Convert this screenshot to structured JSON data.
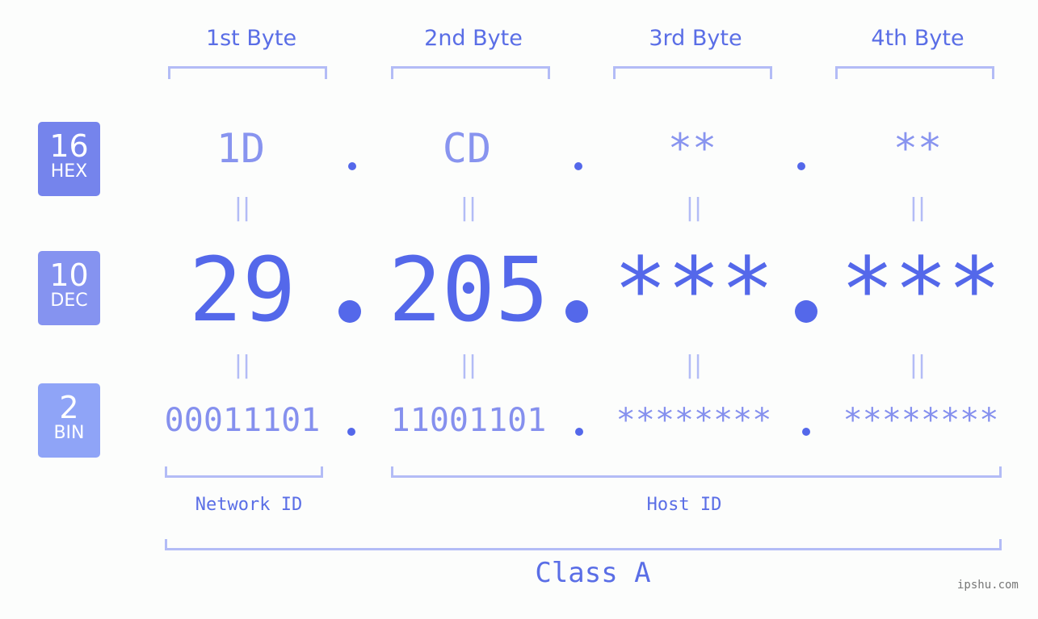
{
  "bytes": [
    {
      "label": "1st Byte",
      "hex": "1D",
      "dec": "29",
      "bin": "00011101"
    },
    {
      "label": "2nd Byte",
      "hex": "CD",
      "dec": "205",
      "bin": "11001101"
    },
    {
      "label": "3rd Byte",
      "hex": "**",
      "dec": "***",
      "bin": "********"
    },
    {
      "label": "4th Byte",
      "hex": "**",
      "dec": "***",
      "bin": "********"
    }
  ],
  "badges": {
    "hex": {
      "num": "16",
      "sub": "HEX",
      "color": "#7584ec"
    },
    "dec": {
      "num": "10",
      "sub": "DEC",
      "color": "#8593f0"
    },
    "bin": {
      "num": "2",
      "sub": "BIN",
      "color": "#8fa4f7"
    }
  },
  "equals_glyph": "||",
  "network_id_label": "Network ID",
  "host_id_label": "Host ID",
  "class_label": "Class A",
  "watermark": "ipshu.com",
  "colors": {
    "accent": "#5468ea",
    "bracket": "#b3bcf6",
    "light_text": "#8894ef"
  }
}
